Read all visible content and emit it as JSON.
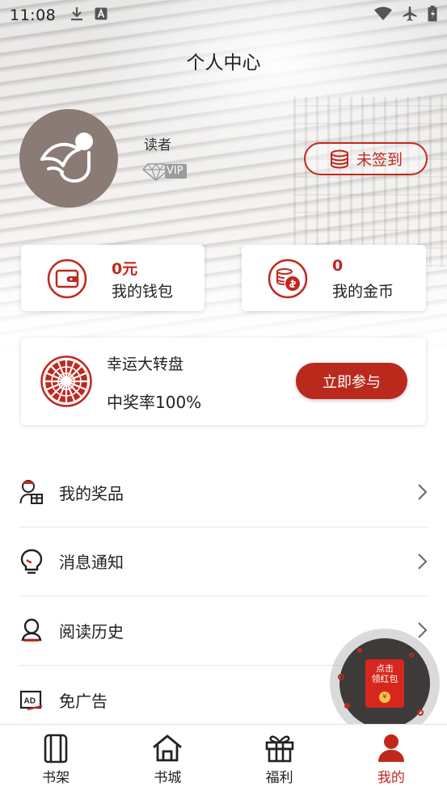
{
  "status_bar": {
    "time": "11:08"
  },
  "header": {
    "title": "个人中心"
  },
  "profile": {
    "name": "读者",
    "vip_label": "VIP",
    "signin_label": "未签到"
  },
  "wallet": {
    "value": "0元",
    "label": "我的钱包"
  },
  "coins": {
    "value": "0",
    "label": "我的金币"
  },
  "lottery": {
    "title": "幸运大转盘",
    "rate": "中奖率100%",
    "button": "立即参与"
  },
  "menu": {
    "items": [
      {
        "label": "我的奖品",
        "icon": "prize-icon"
      },
      {
        "label": "消息通知",
        "icon": "notification-icon"
      },
      {
        "label": "阅读历史",
        "icon": "reading-history-icon"
      },
      {
        "label": "免广告",
        "icon": "ad-free-icon"
      }
    ]
  },
  "float_button": {
    "line1": "点击",
    "line2": "领红包",
    "coin": "¥"
  },
  "tabs": [
    {
      "label": "书架",
      "icon": "bookshelf-icon",
      "active": false
    },
    {
      "label": "书城",
      "icon": "bookstore-icon",
      "active": false
    },
    {
      "label": "福利",
      "icon": "gift-icon",
      "active": false
    },
    {
      "label": "我的",
      "icon": "profile-icon",
      "active": true
    }
  ],
  "colors": {
    "accent": "#c0281e",
    "avatar_bg": "#8a7b74",
    "text": "#222222"
  }
}
